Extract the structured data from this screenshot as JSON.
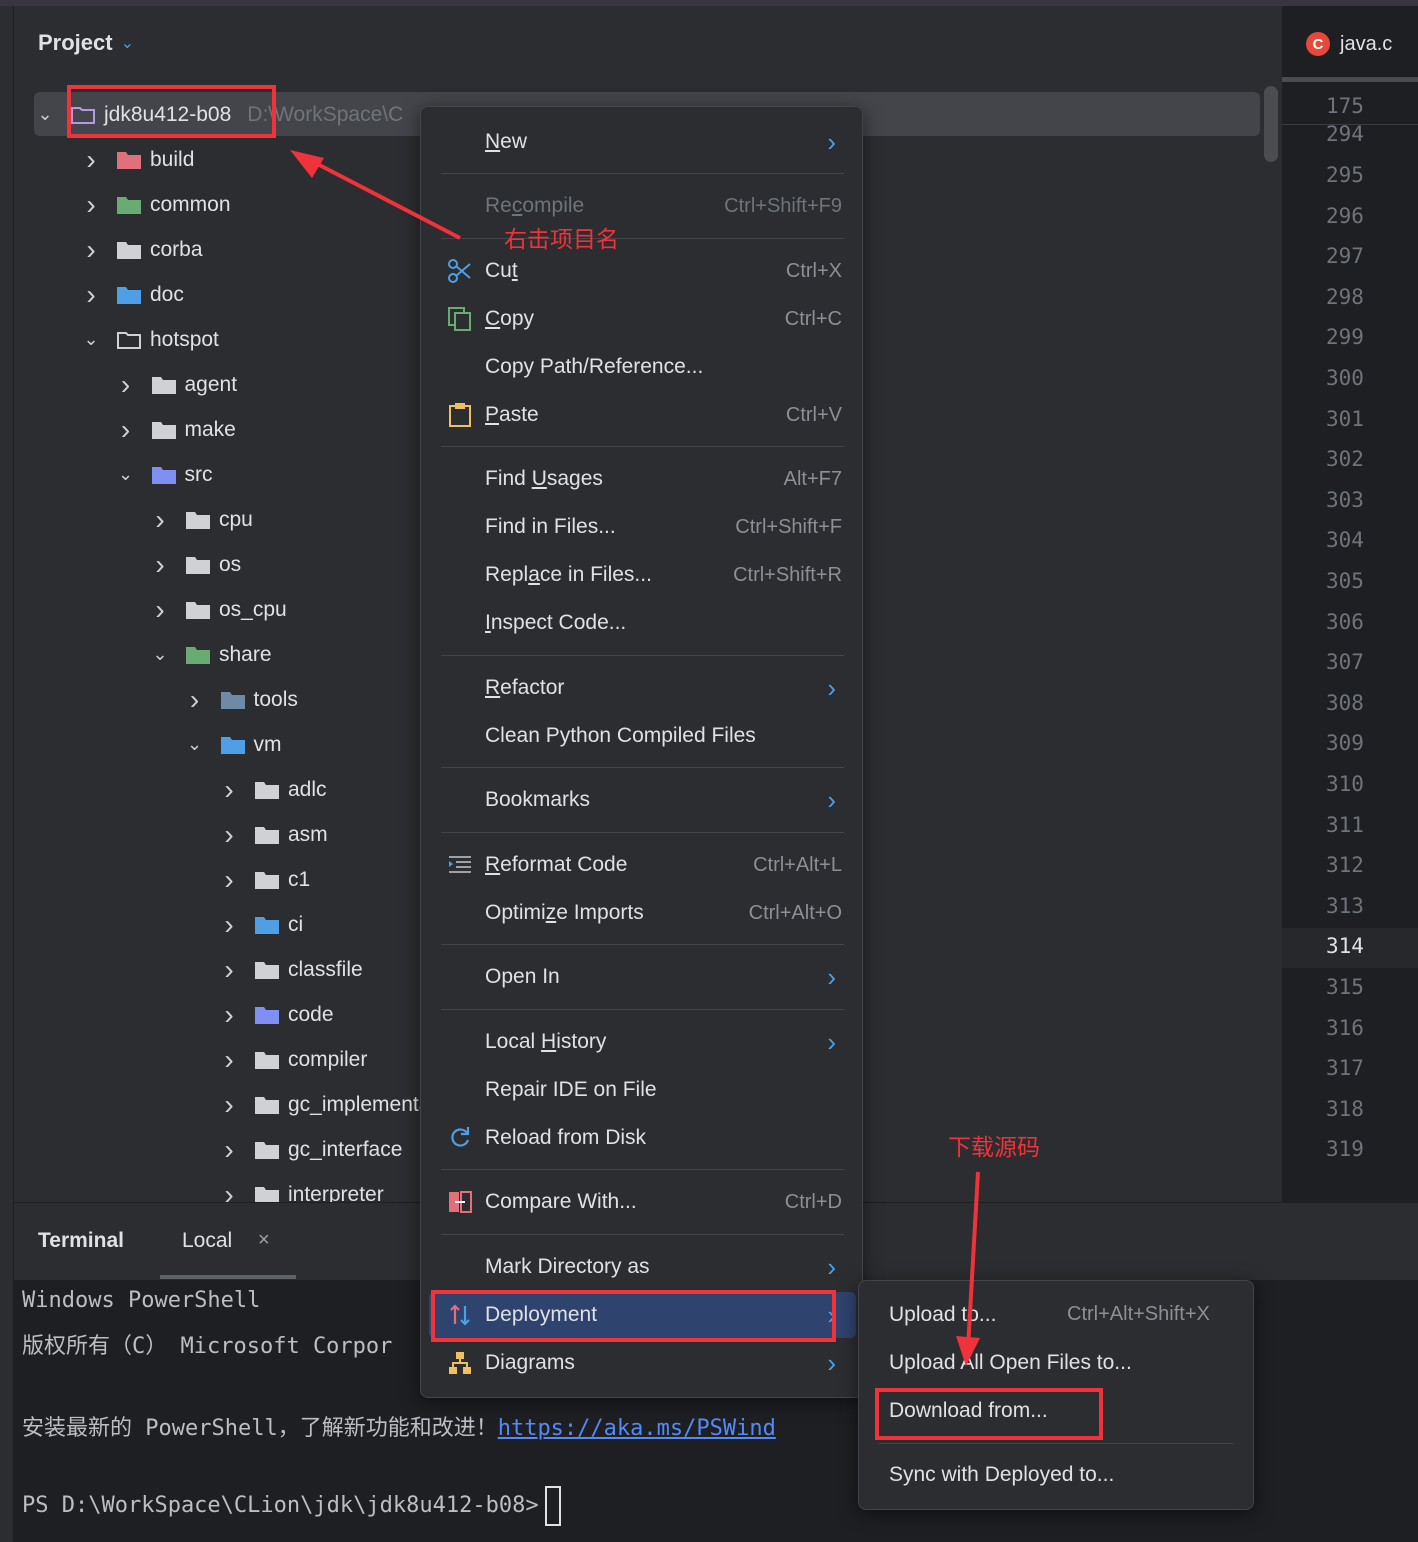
{
  "project": {
    "title": "Project",
    "root_name": "jdk8u412-b08",
    "root_path": "D:\\WorkSpace\\C",
    "tree": [
      {
        "label": "build",
        "indent": 0,
        "expanded": false,
        "icon": "folder-excluded"
      },
      {
        "label": "common",
        "indent": 0,
        "expanded": false,
        "icon": "folder-resources"
      },
      {
        "label": "corba",
        "indent": 0,
        "expanded": false,
        "icon": "folder"
      },
      {
        "label": "doc",
        "indent": 0,
        "expanded": false,
        "icon": "folder-doc"
      },
      {
        "label": "hotspot",
        "indent": 0,
        "expanded": true,
        "icon": "folder-open"
      },
      {
        "label": "agent",
        "indent": 1,
        "expanded": false,
        "icon": "folder"
      },
      {
        "label": "make",
        "indent": 1,
        "expanded": false,
        "icon": "folder"
      },
      {
        "label": "src",
        "indent": 1,
        "expanded": true,
        "icon": "folder-source"
      },
      {
        "label": "cpu",
        "indent": 2,
        "expanded": false,
        "icon": "folder"
      },
      {
        "label": "os",
        "indent": 2,
        "expanded": false,
        "icon": "folder"
      },
      {
        "label": "os_cpu",
        "indent": 2,
        "expanded": false,
        "icon": "folder"
      },
      {
        "label": "share",
        "indent": 2,
        "expanded": true,
        "icon": "folder-resources"
      },
      {
        "label": "tools",
        "indent": 3,
        "expanded": false,
        "icon": "folder-tools"
      },
      {
        "label": "vm",
        "indent": 3,
        "expanded": true,
        "icon": "folder-module"
      },
      {
        "label": "adlc",
        "indent": 4,
        "expanded": false,
        "icon": "folder"
      },
      {
        "label": "asm",
        "indent": 4,
        "expanded": false,
        "icon": "folder"
      },
      {
        "label": "c1",
        "indent": 4,
        "expanded": false,
        "icon": "folder"
      },
      {
        "label": "ci",
        "indent": 4,
        "expanded": false,
        "icon": "folder-ci"
      },
      {
        "label": "classfile",
        "indent": 4,
        "expanded": false,
        "icon": "folder"
      },
      {
        "label": "code",
        "indent": 4,
        "expanded": false,
        "icon": "folder-source"
      },
      {
        "label": "compiler",
        "indent": 4,
        "expanded": false,
        "icon": "folder"
      },
      {
        "label": "gc_implementation",
        "indent": 4,
        "expanded": false,
        "icon": "folder"
      },
      {
        "label": "gc_interface",
        "indent": 4,
        "expanded": false,
        "icon": "folder"
      },
      {
        "label": "interpreter",
        "indent": 4,
        "expanded": false,
        "icon": "folder"
      }
    ]
  },
  "editor": {
    "tab_label": "java.c",
    "tab_icon_letter": "C",
    "line_numbers": [
      "175",
      "294",
      "295",
      "296",
      "297",
      "298",
      "299",
      "300",
      "301",
      "302",
      "303",
      "304",
      "305",
      "306",
      "307",
      "308",
      "309",
      "310",
      "311",
      "312",
      "313",
      "314",
      "315",
      "316",
      "317",
      "318",
      "319"
    ],
    "current_line": "314"
  },
  "terminal": {
    "title": "Terminal",
    "tab_label": "Local",
    "close_glyph": "×",
    "lines": [
      "Windows PowerShell",
      "版权所有（C） Microsoft Corpor",
      "安装最新的 PowerShell，了解新功能和改进！"
    ],
    "link": "https://aka.ms/PSWind",
    "prompt": "PS D:\\WorkSpace\\CLion\\jdk\\jdk8u412-b08>"
  },
  "context_menu": {
    "items": [
      {
        "label": "New",
        "mnemonic": "N",
        "submenu": true
      },
      {
        "label": "Recompile",
        "mnemonic": "c",
        "shortcut": "Ctrl+Shift+F9",
        "disabled": true
      },
      {
        "label": "Cut",
        "mnemonic": "t",
        "shortcut": "Ctrl+X",
        "icon": "scissors-icon"
      },
      {
        "label": "Copy",
        "mnemonic": "C",
        "shortcut": "Ctrl+C",
        "icon": "copy-icon"
      },
      {
        "label": "Copy Path/Reference..."
      },
      {
        "label": "Paste",
        "mnemonic": "P",
        "shortcut": "Ctrl+V",
        "icon": "clipboard-icon"
      },
      {
        "label": "Find Usages",
        "mnemonic": "U",
        "shortcut": "Alt+F7"
      },
      {
        "label": "Find in Files...",
        "shortcut": "Ctrl+Shift+F"
      },
      {
        "label": "Replace in Files...",
        "mnemonic": "a",
        "shortcut": "Ctrl+Shift+R"
      },
      {
        "label": "Inspect Code...",
        "mnemonic": "I"
      },
      {
        "label": "Refactor",
        "mnemonic": "R",
        "submenu": true
      },
      {
        "label": "Clean Python Compiled Files"
      },
      {
        "label": "Bookmarks",
        "submenu": true
      },
      {
        "label": "Reformat Code",
        "mnemonic": "R",
        "shortcut": "Ctrl+Alt+L",
        "icon": "reformat-icon"
      },
      {
        "label": "Optimize Imports",
        "mnemonic": "z",
        "shortcut": "Ctrl+Alt+O"
      },
      {
        "label": "Open In",
        "submenu": true
      },
      {
        "label": "Local History",
        "mnemonic": "H",
        "submenu": true
      },
      {
        "label": "Repair IDE on File"
      },
      {
        "label": "Reload from Disk",
        "icon": "reload-icon"
      },
      {
        "label": "Compare With...",
        "shortcut": "Ctrl+D",
        "icon": "compare-icon"
      },
      {
        "label": "Mark Directory as",
        "submenu": true
      },
      {
        "label": "Deployment",
        "submenu": true,
        "selected": true,
        "icon": "deployment-icon"
      },
      {
        "label": "Diagrams",
        "submenu": true,
        "icon": "diagram-icon"
      }
    ]
  },
  "deployment_submenu": {
    "items": [
      {
        "label": "Upload to...",
        "shortcut": "Ctrl+Alt+Shift+X"
      },
      {
        "label": "Upload All Open Files to..."
      },
      {
        "label": "Download from..."
      },
      {
        "label": "Sync with Deployed to..."
      }
    ]
  },
  "annotations": {
    "right_click_note": "右击项目名",
    "download_note": "下载源码",
    "color": "#f0333a"
  },
  "colors": {
    "background": "#2b2d30",
    "editor": "#1e1f22",
    "selection": "#2e436e",
    "accent": "#4e9fe6"
  }
}
